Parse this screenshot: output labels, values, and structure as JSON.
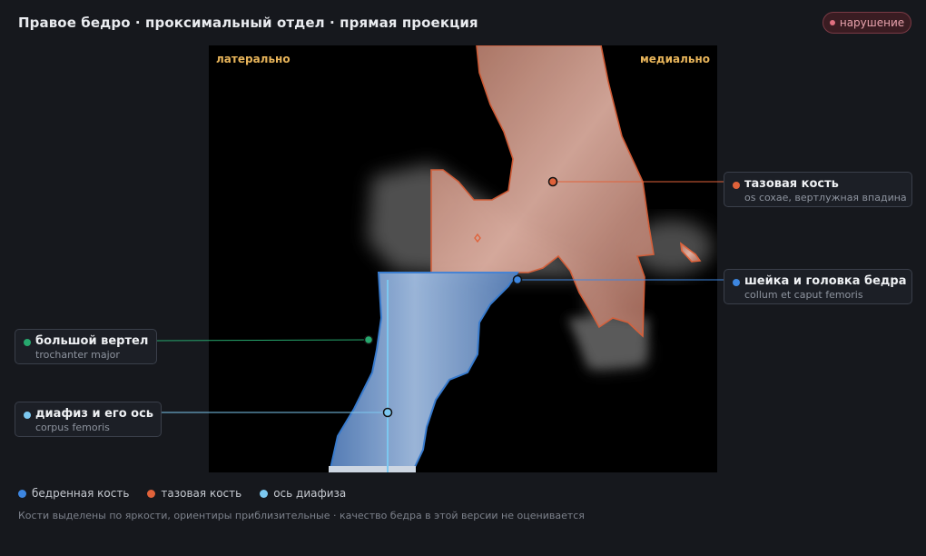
{
  "header": {
    "title": "Правое бедро · проксимальный отдел · прямая проекция",
    "badge": "нарушение"
  },
  "image": {
    "orientation_left": "латерально",
    "orientation_right": "медиально"
  },
  "callouts": [
    {
      "id": "pelvis",
      "label": "тазовая кость",
      "sub": "os coxae, вертлужная впадина",
      "color": "#e0623a"
    },
    {
      "id": "neck",
      "label": "шейка и головка бедра",
      "sub": "collum et caput femoris",
      "color": "#3d86e0"
    },
    {
      "id": "trochanter",
      "label": "большой вертел",
      "sub": "trochanter major",
      "color": "#27a86e"
    },
    {
      "id": "shaft",
      "label": "диафиз и его ось",
      "sub": "corpus femoris",
      "color": "#7cc8f0"
    }
  ],
  "legend": [
    {
      "label": "бедренная кость",
      "color": "#3d86e0"
    },
    {
      "label": "тазовая кость",
      "color": "#e0623a"
    },
    {
      "label": "ось диафиза",
      "color": "#7cc8f0"
    }
  ],
  "footer_note": "Кости выделены по яркости, ориентиры приблизительные · качество бедра в этой версии не оценивается",
  "colors": {
    "background": "#16181d",
    "femur_mask": "#3d86e0",
    "pelvis_mask": "#e0623a",
    "shaft_axis": "#7cc8f0",
    "alert": "#e07080"
  }
}
